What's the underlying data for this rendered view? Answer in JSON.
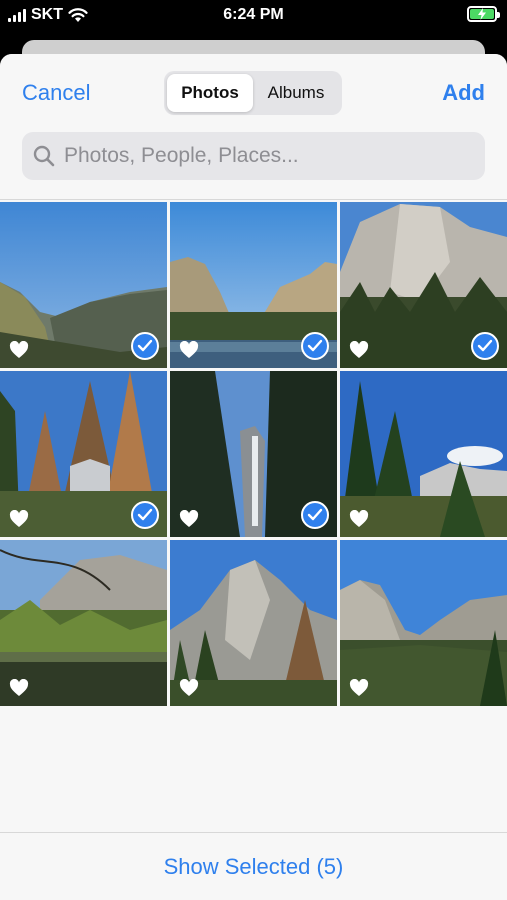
{
  "status_bar": {
    "carrier": "SKT",
    "time": "6:24 PM",
    "icons": [
      "signal-icon",
      "wifi-icon",
      "battery-charging-icon"
    ]
  },
  "nav": {
    "cancel_label": "Cancel",
    "add_label": "Add",
    "tabs": [
      {
        "label": "Photos",
        "selected": true
      },
      {
        "label": "Albums",
        "selected": false
      }
    ]
  },
  "search": {
    "placeholder": "Photos, People, Places..."
  },
  "photos": [
    {
      "name": "valley-cliff",
      "selected": true
    },
    {
      "name": "el-capitan-river",
      "selected": true
    },
    {
      "name": "el-capitan-forest",
      "selected": true
    },
    {
      "name": "autumn-trees",
      "selected": true
    },
    {
      "name": "yosemite-falls",
      "selected": true
    },
    {
      "name": "pines-half-dome",
      "selected": false
    },
    {
      "name": "merced-river-falls",
      "selected": false
    },
    {
      "name": "cathedral-rocks",
      "selected": false
    },
    {
      "name": "valley-view",
      "selected": false
    }
  ],
  "bottom": {
    "show_selected_label": "Show Selected (5)"
  },
  "colors": {
    "accent": "#2f80ed",
    "battery": "#4cd964"
  }
}
